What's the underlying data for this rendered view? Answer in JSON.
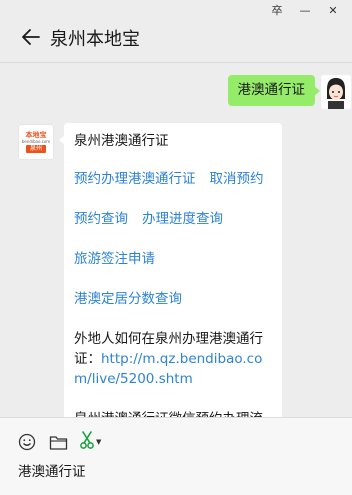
{
  "window_controls": {
    "pin_glyph": "卒",
    "minimize_glyph": "—",
    "close_glyph": "✕"
  },
  "header": {
    "title": "泉州本地宝"
  },
  "chat": {
    "user_message": "港澳通行证",
    "bot_logo": {
      "top_text": "本地宝",
      "url_text": "bendibao.com",
      "bottom_text": "泉州"
    },
    "bot_message": {
      "title": "泉州港澳通行证",
      "links_row1": [
        "预约办理港澳通行证",
        "取消预约"
      ],
      "links_row2": [
        "预约查询",
        "办理进度查询"
      ],
      "link_row3": "旅游签注申请",
      "link_row4": "港澳定居分数查询",
      "paragraph_prefix": "外地人如何在泉州办理港澳通行证：",
      "paragraph_link": "http://m.qz.bendibao.com/live/5200.shtm",
      "trailing_text": "泉州港澳通行证微信预约办理流"
    }
  },
  "input": {
    "value": "港澳通行证"
  },
  "colors": {
    "accent_green": "#95ec69",
    "link_blue": "#2d83d6",
    "scissor_green": "#15a03c",
    "logo_orange": "#e8541c"
  }
}
